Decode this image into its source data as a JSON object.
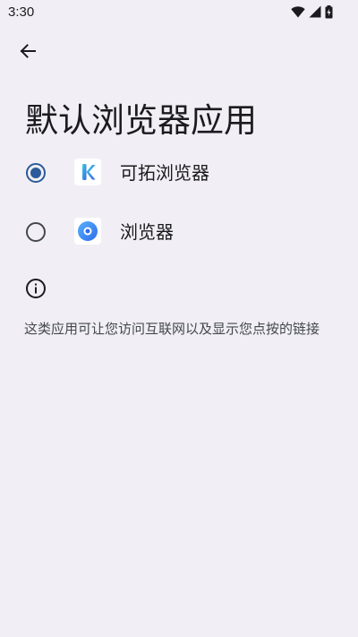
{
  "status_bar": {
    "time": "3:30"
  },
  "header": {
    "title": "默认浏览器应用"
  },
  "options": [
    {
      "label": "可拓浏览器",
      "selected": true,
      "icon": "k-browser-icon"
    },
    {
      "label": "浏览器",
      "selected": false,
      "icon": "browser-icon"
    }
  ],
  "footer": {
    "description": "这类应用可让您访问互联网以及显示您点按的链接"
  },
  "colors": {
    "background": "#f1eff5",
    "accent": "#2b5b9a",
    "text_primary": "#1b1b1f",
    "text_secondary": "#44474f"
  }
}
